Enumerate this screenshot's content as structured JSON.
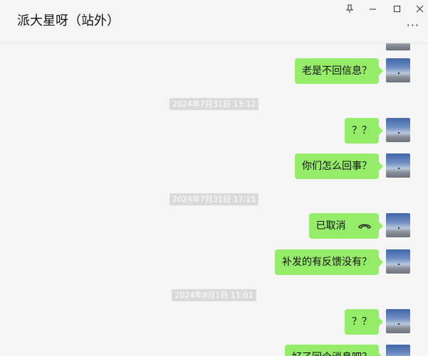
{
  "header": {
    "title": "派大星呀（站外）"
  },
  "window_controls": {
    "pin": "🖈",
    "minimize": "—",
    "maximize": "☐",
    "close": "✕",
    "more": "···"
  },
  "messages": [
    {
      "type": "bubble",
      "text": ""
    },
    {
      "type": "bubble",
      "text": "老是不回信息？"
    },
    {
      "type": "time",
      "text": "2024年7月31日 13:12"
    },
    {
      "type": "bubble",
      "text": "？？"
    },
    {
      "type": "bubble",
      "text": "你们怎么回事？"
    },
    {
      "type": "time",
      "text": "2024年7月31日 17:15"
    },
    {
      "type": "call",
      "text": "已取消"
    },
    {
      "type": "bubble",
      "text": "补发的有反馈没有？"
    },
    {
      "type": "time",
      "text": "2024年8月1日 11:01"
    },
    {
      "type": "bubble",
      "text": "？？"
    },
    {
      "type": "bubble",
      "text": "好了回个消息吧？"
    }
  ],
  "colors": {
    "bubble": "#95ec69",
    "background": "#f5f5f5",
    "timestamp_bg": "#dadada"
  }
}
